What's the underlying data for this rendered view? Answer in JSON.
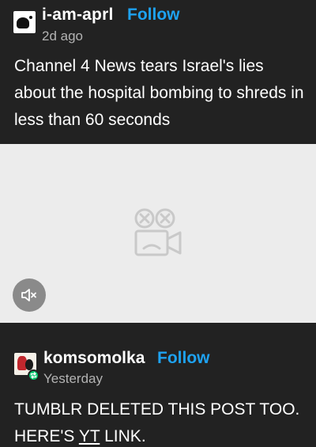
{
  "post1": {
    "username": "i-am-aprl",
    "follow_label": "Follow",
    "timestamp": "2d ago",
    "body": "Channel 4 News tears Israel's lies about the hospital bombing to shreds in less than 60 seconds"
  },
  "video": {
    "placeholder_icon": "broken-video-icon",
    "mute_icon": "muted-speaker-icon"
  },
  "post2": {
    "username": "komsomolka",
    "follow_label": "Follow",
    "timestamp": "Yesterday",
    "badge_icon": "reblog-icon",
    "body_before": "TUMBLR DELETED THIS POST TOO. HERE'S ",
    "link_text": "YT",
    "body_after": " LINK."
  },
  "colors": {
    "background": "#222222",
    "accent": "#1ea2f1",
    "muted_text": "#b3b3b3",
    "video_bg": "#ececec",
    "reblog_badge": "#00c46a"
  }
}
